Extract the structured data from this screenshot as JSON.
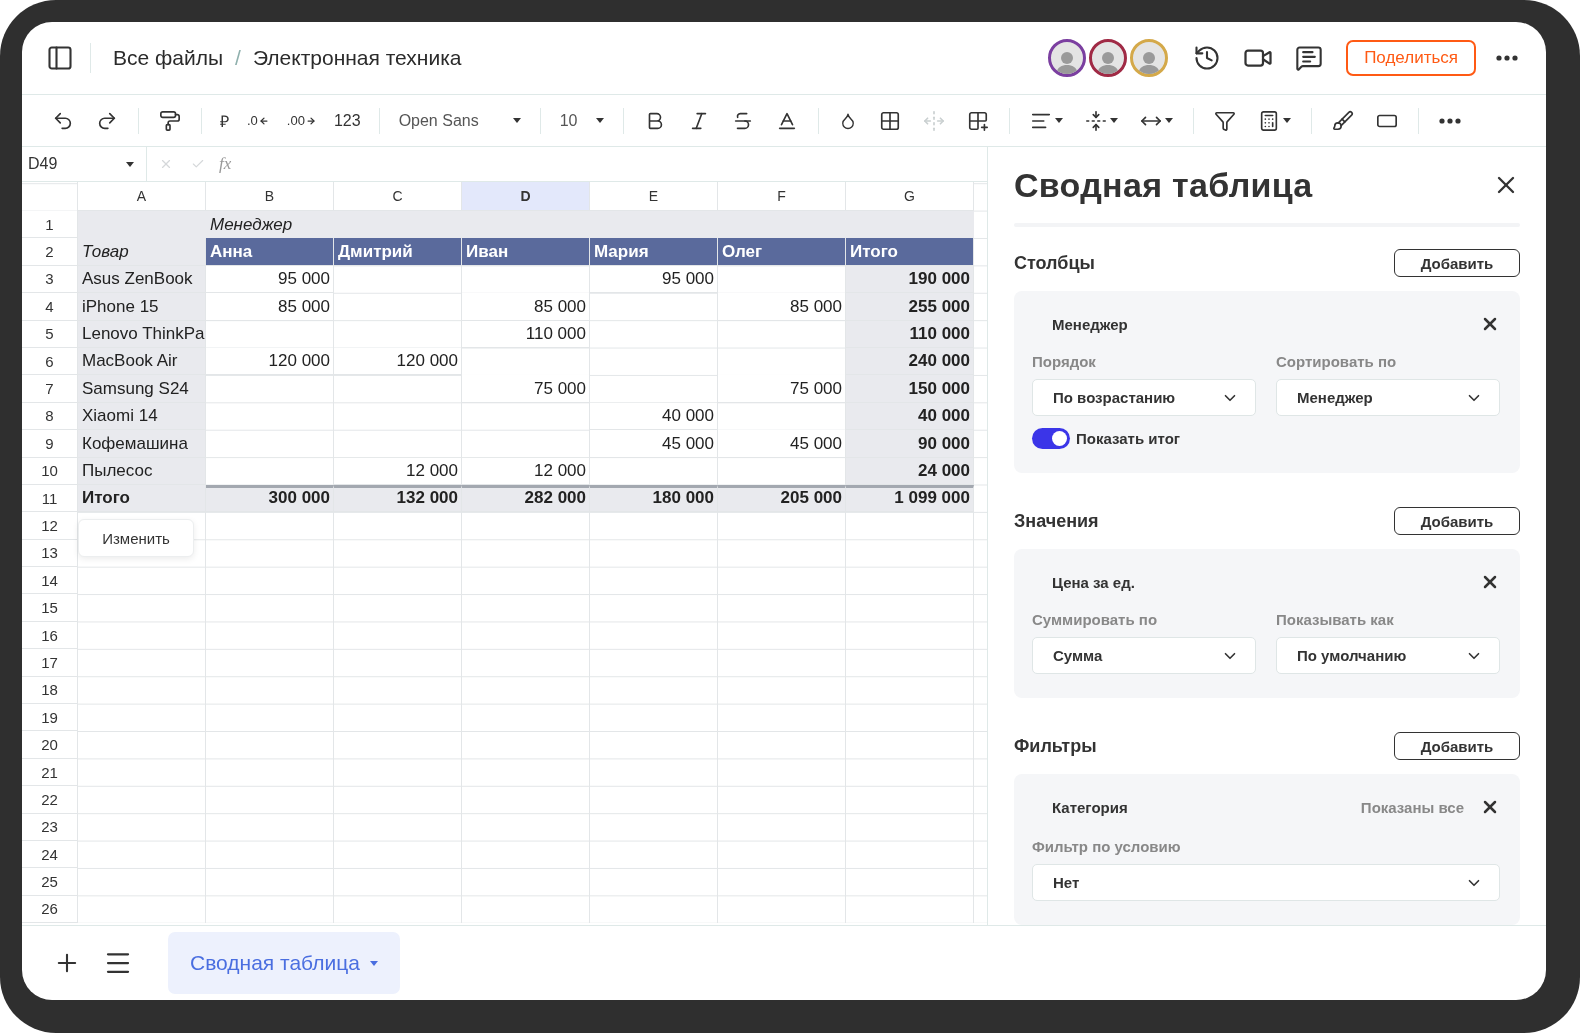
{
  "header": {
    "breadcrumbs": [
      "Все файлы",
      "Электронная техника"
    ],
    "breadcrumb_separator": "/",
    "avatars": [
      {
        "color": "#7b3fa0"
      },
      {
        "color": "#a02a45"
      },
      {
        "color": "#d4a94a"
      }
    ],
    "share_button": "Поделиться"
  },
  "toolbar": {
    "currency": "₽",
    "decrease_decimals": ".0",
    "increase_decimals": ".00",
    "number_format": "123",
    "font": "Open Sans",
    "font_size": "10",
    "merge_disabled": true
  },
  "formula_bar": {
    "cell_ref": "D49",
    "fx": "fx"
  },
  "sheet": {
    "columns": [
      {
        "label": "A",
        "selected": false
      },
      {
        "label": "B",
        "selected": false
      },
      {
        "label": "C",
        "selected": false
      },
      {
        "label": "D",
        "selected": true
      },
      {
        "label": "E",
        "selected": false
      },
      {
        "label": "F",
        "selected": false
      },
      {
        "label": "G",
        "selected": false
      }
    ],
    "row_numbers": [
      "1",
      "2",
      "3",
      "4",
      "5",
      "6",
      "7",
      "8",
      "9",
      "10",
      "11",
      "12",
      "13",
      "14",
      "15",
      "16",
      "17",
      "18",
      "19",
      "20",
      "21",
      "22",
      "23",
      "24",
      "25",
      "26"
    ],
    "pivot": {
      "column_field": "Менеджер",
      "row_field": "Товар",
      "column_headers": [
        "Анна",
        "Дмитрий",
        "Иван",
        "Мария",
        "Олег",
        "Итого"
      ],
      "rows": [
        {
          "label": "Asus ZenBook",
          "values": {
            "B": "95 000",
            "E": "95 000"
          },
          "total": "190 000"
        },
        {
          "label": "iPhone 15",
          "values": {
            "B": "85 000",
            "D": "85 000",
            "F": "85 000"
          },
          "total": "255 000"
        },
        {
          "label": "Lenovo ThinkPa",
          "values": {
            "D": "110 000"
          },
          "total": "110 000"
        },
        {
          "label": "MacBook Air",
          "values": {
            "B": "120 000",
            "C": "120 000"
          },
          "total": "240 000"
        },
        {
          "label": "Samsung S24",
          "values": {
            "D": "75 000",
            "F": "75 000"
          },
          "total": "150 000"
        },
        {
          "label": "Xiaomi 14",
          "values": {
            "E": "40 000"
          },
          "total": "40 000"
        },
        {
          "label": "Кофемашина",
          "values": {
            "E": "45 000",
            "F": "45 000"
          },
          "total": "90 000"
        },
        {
          "label": "Пылесос",
          "values": {
            "C": "12 000",
            "D": "12 000"
          },
          "total": "24 000"
        }
      ],
      "grand_total": {
        "label": "Итого",
        "values": {
          "B": "300 000",
          "C": "132 000",
          "D": "282 000",
          "E": "180 000",
          "F": "205 000"
        },
        "total": "1 099 000"
      }
    },
    "edit_button": "Изменить"
  },
  "panel": {
    "title": "Сводная таблица",
    "sections": [
      {
        "title": "Столбцы",
        "add_button": "Добавить",
        "card": {
          "field": "Менеджер",
          "selects": [
            {
              "label": "Порядок",
              "value": "По возрастанию"
            },
            {
              "label": "Сортировать по",
              "value": "Менеджер"
            }
          ],
          "toggle": {
            "label": "Показать итог",
            "on": true
          }
        }
      },
      {
        "title": "Значения",
        "add_button": "Добавить",
        "card": {
          "field": "Цена за ед.",
          "selects": [
            {
              "label": "Суммировать по",
              "value": "Сумма"
            },
            {
              "label": "Показывать как",
              "value": "По умолчанию"
            }
          ]
        }
      },
      {
        "title": "Фильтры",
        "add_button": "Добавить",
        "card": {
          "field": "Категория",
          "status": "Показаны все",
          "wide_select": {
            "label": "Фильтр по условию",
            "value": "Нет"
          }
        }
      }
    ]
  },
  "sheet_tabs": [
    {
      "label": "Сводная таблица",
      "selected": true
    }
  ]
}
